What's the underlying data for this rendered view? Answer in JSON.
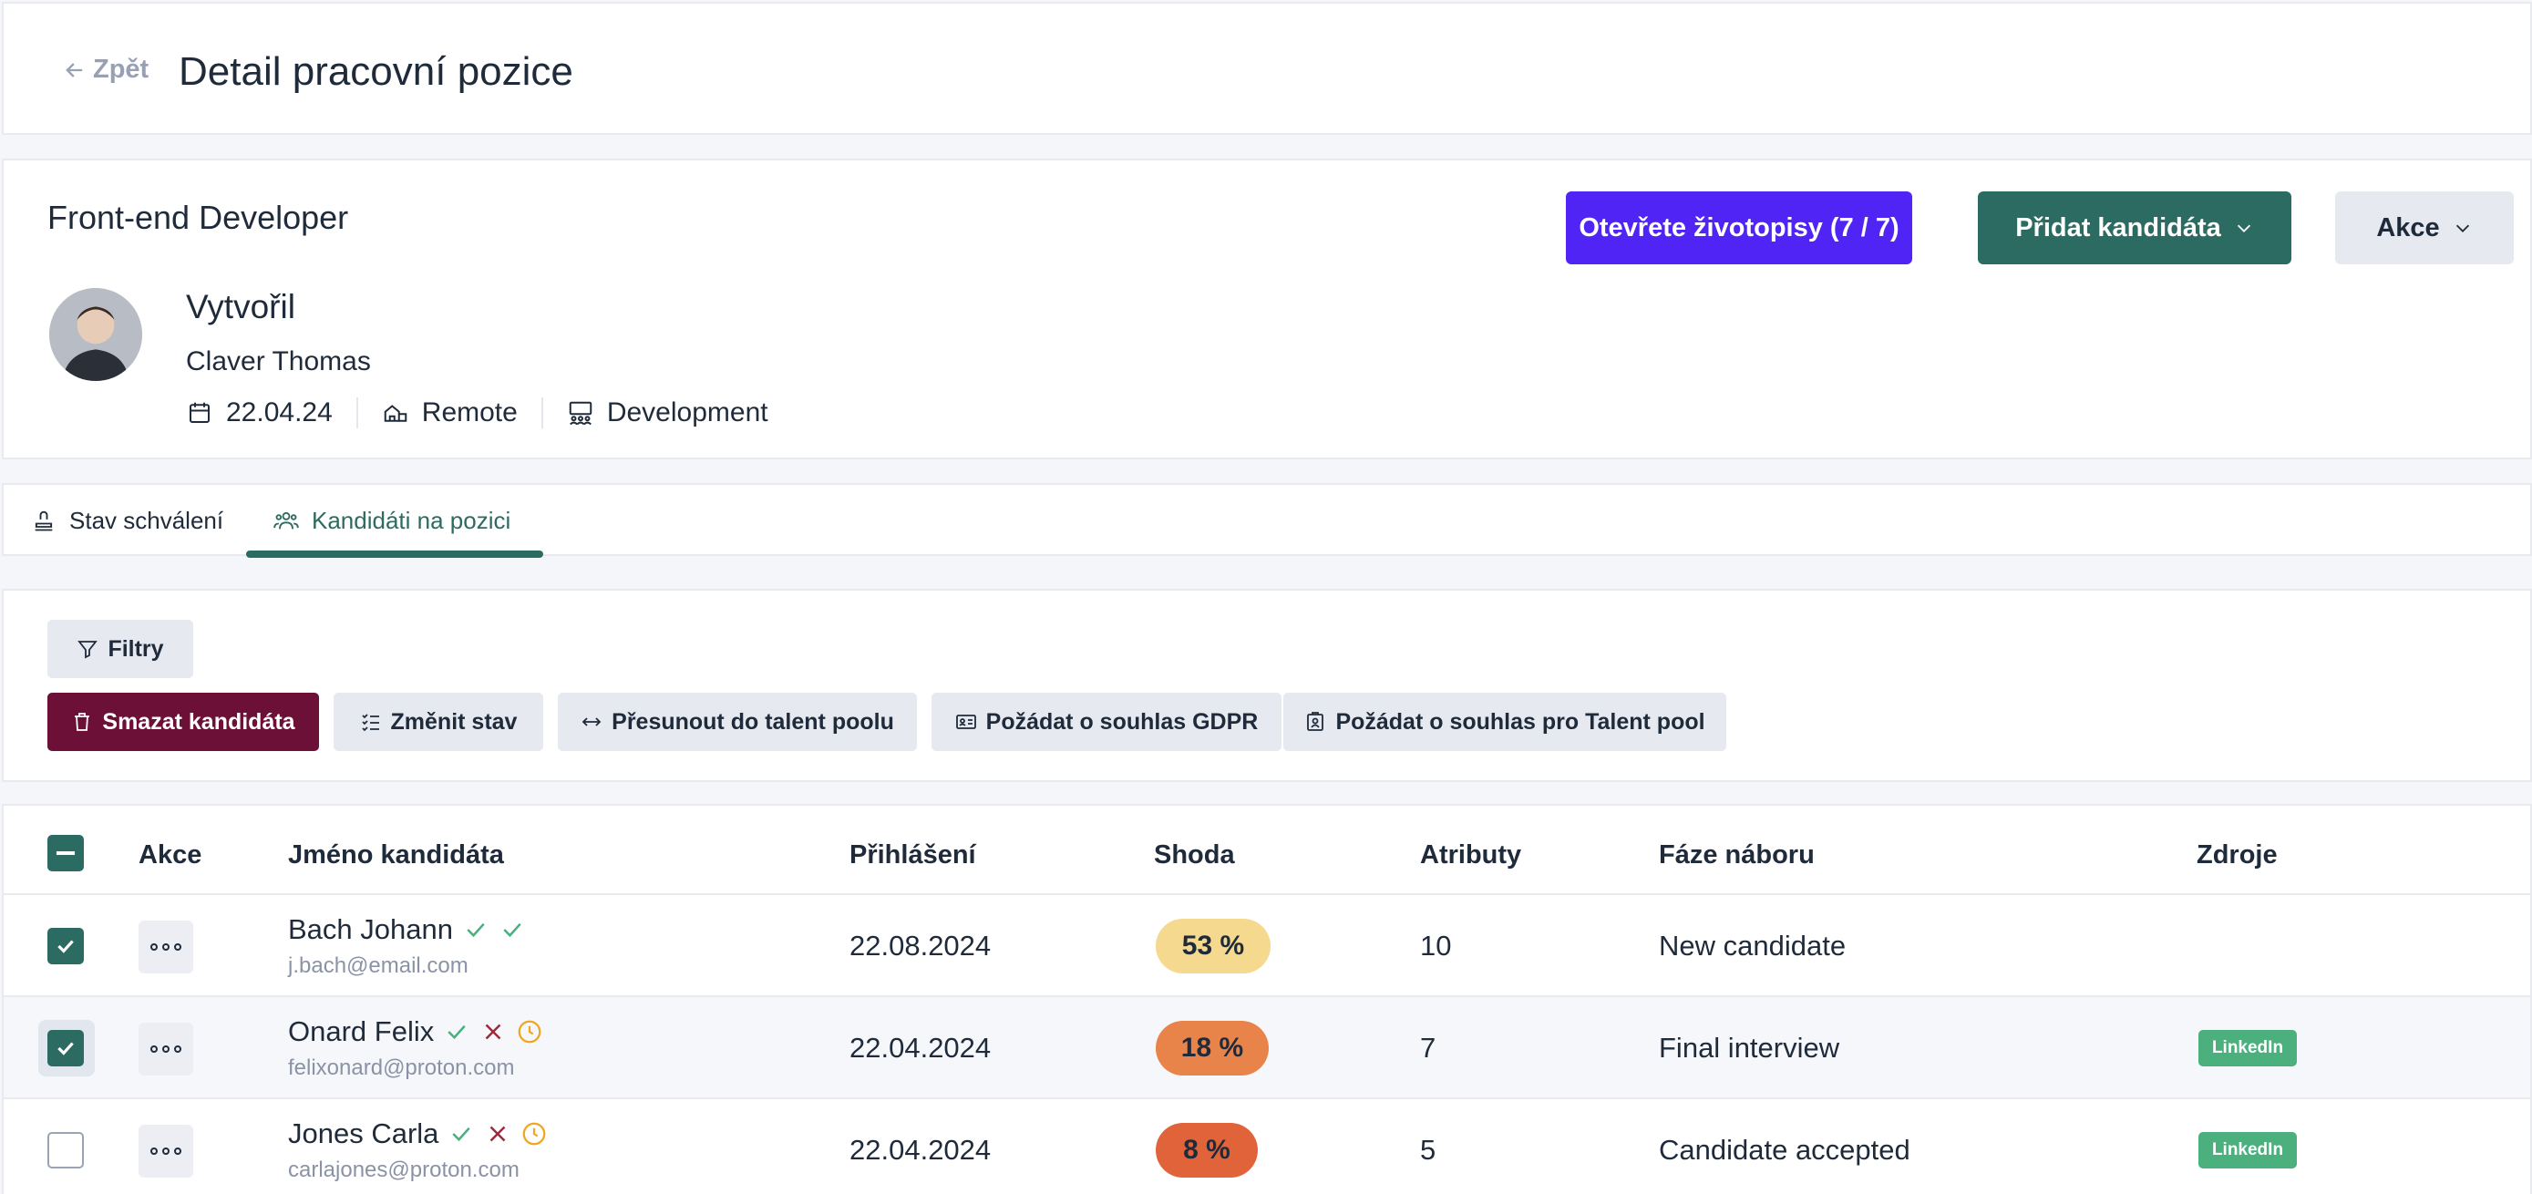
{
  "header": {
    "back_label": "Zpět",
    "title": "Detail pracovní pozice"
  },
  "position": {
    "title": "Front-end Developer",
    "created_by_label": "Vytvořil",
    "creator_name": "Claver Thomas",
    "date": "22.04.24",
    "work_mode": "Remote",
    "department": "Development",
    "open_cv_button": "Otevřete životopisy (7 / 7)",
    "add_candidate_button": "Přidat kandidáta",
    "actions_button": "Akce"
  },
  "tabs": [
    {
      "label": "Stav schválení",
      "icon": "stamp-icon",
      "active": false
    },
    {
      "label": "Kandidáti na pozici",
      "icon": "users-icon",
      "active": true
    }
  ],
  "toolbar": {
    "filters": "Filtry",
    "delete": "Smazat kandidáta",
    "change_status": "Změnit stav",
    "move_talent": "Přesunout do talent poolu",
    "gdpr": "Požádat o souhlas GDPR",
    "talent_consent": "Požádat o souhlas pro Talent pool"
  },
  "table": {
    "columns": [
      "Akce",
      "Jméno kandidáta",
      "Přihlášení",
      "Shoda",
      "Atributy",
      "Fáze náboru",
      "Zdroje"
    ],
    "rows": [
      {
        "checked": true,
        "name": "Bach Johann",
        "email": "j.bach@email.com",
        "date": "22.08.2024",
        "match": "53 %",
        "match_color": "#f5d98f",
        "attributes": "10",
        "phase": "New candidate",
        "source": "",
        "status_icons": [
          "check-icon",
          "check-icon"
        ]
      },
      {
        "checked": true,
        "name": "Onard Felix",
        "email": "felixonard@proton.com",
        "date": "22.04.2024",
        "match": "18 %",
        "match_color": "#e8834a",
        "attributes": "7",
        "phase": "Final interview",
        "source": "LinkedIn",
        "status_icons": [
          "check-icon",
          "cross-icon",
          "clock-icon"
        ]
      },
      {
        "checked": false,
        "name": "Jones Carla",
        "email": "carlajones@proton.com",
        "date": "22.04.2024",
        "match": "8 %",
        "match_color": "#e0633a",
        "attributes": "5",
        "phase": "Candidate accepted",
        "source": "LinkedIn",
        "status_icons": [
          "check-icon",
          "cross-icon",
          "clock-icon"
        ]
      }
    ]
  },
  "colors": {
    "primary": "#5024f5",
    "accent": "#2c6b61",
    "danger": "#6d1037",
    "source_badge": "#4caf7e"
  }
}
